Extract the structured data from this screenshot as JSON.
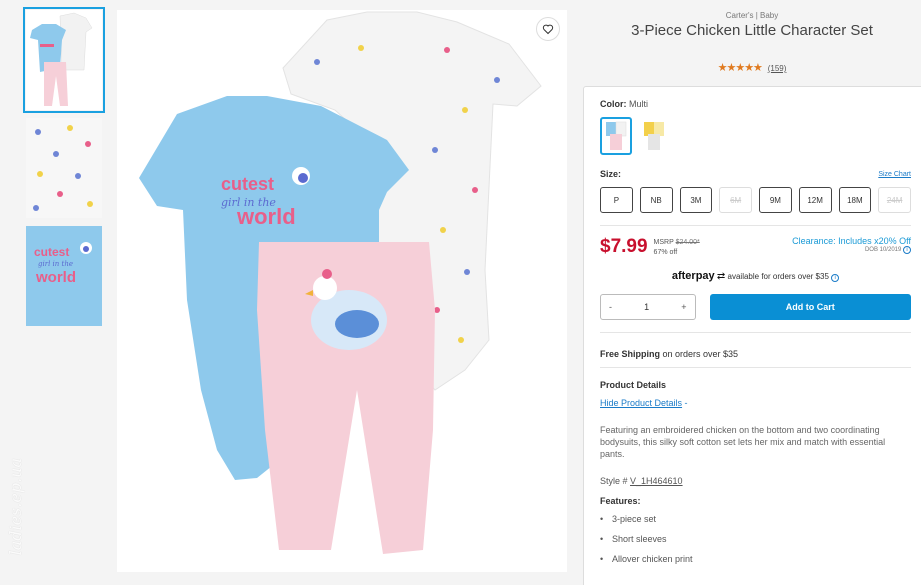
{
  "product": {
    "brand": "Carter's | Baby",
    "title": "3-Piece Chicken Little Character Set",
    "stars": "★★★★★",
    "reviews": "(159)"
  },
  "graphic_text": {
    "line1": "cutest",
    "line2": "girl in the",
    "line3": "world"
  },
  "watermark": "ladies.ep.ua",
  "color": {
    "label": "Color:",
    "value": "Multi"
  },
  "size": {
    "label": "Size:",
    "chart_link": "Size Chart",
    "options": [
      {
        "label": "P",
        "available": true
      },
      {
        "label": "NB",
        "available": true
      },
      {
        "label": "3M",
        "available": true
      },
      {
        "label": "6M",
        "available": false
      },
      {
        "label": "9M",
        "available": true
      },
      {
        "label": "12M",
        "available": true
      },
      {
        "label": "18M",
        "available": true
      },
      {
        "label": "24M",
        "available": false
      }
    ]
  },
  "pricing": {
    "price": "$7.99",
    "msrp_label": "MSRP",
    "msrp_value": "$24.00*",
    "discount": "67% off",
    "clearance": "Clearance: Includes x20% Off",
    "dob": "DOB 10/2019"
  },
  "afterpay": {
    "logo": "afterpay",
    "text": "available for orders over $35",
    "info": "i"
  },
  "cart": {
    "minus": "-",
    "qty": "1",
    "plus": "+",
    "add_label": "Add to Cart"
  },
  "shipping": {
    "bold": "Free Shipping",
    "rest": " on orders over $35"
  },
  "details": {
    "heading": "Product Details",
    "hide_link": "Hide Product Details",
    "hide_suffix": " -",
    "description": "Featuring an embroidered chicken on the bottom and two coordinating bodysuits, this silky soft cotton set lets her mix and match with essential pants.",
    "style_label": "Style # ",
    "style_value": "V_1H464610",
    "features_heading": "Features:",
    "features": [
      "3-piece set",
      "Short sleeves",
      "Allover chicken print"
    ]
  },
  "colors": {
    "accent": "#1aa0e0",
    "price_red": "#c8102e",
    "button_blue": "#0a8fd4",
    "blue_bodysuit": "#8ec9ec",
    "pink_pants": "#f6cfd8",
    "graphic_pink": "#e85f8a"
  }
}
